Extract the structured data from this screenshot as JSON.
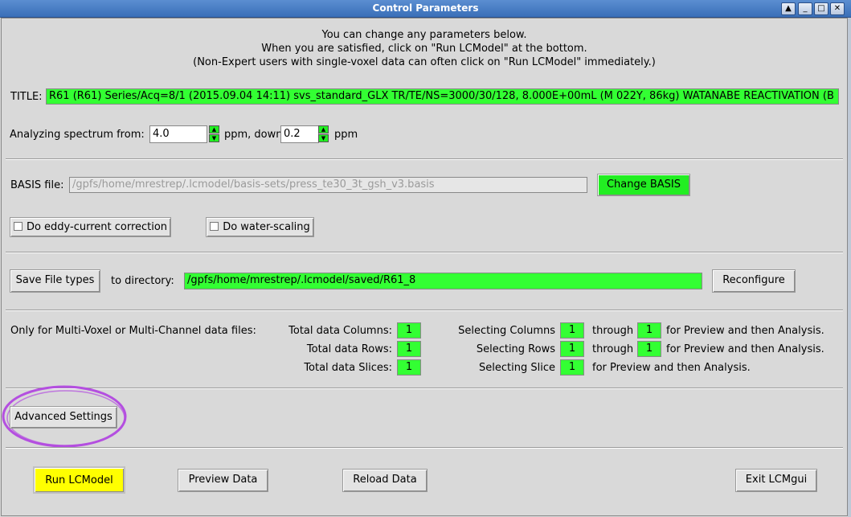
{
  "window": {
    "title": "Control Parameters"
  },
  "intro": [
    "You can change any parameters below.",
    "When you are satisfied, click on \"Run LCModel\" at the bottom.",
    "(Non-Expert users with single-voxel data can often click on \"Run LCModel\" immediately.)"
  ],
  "title_row": {
    "label": "TITLE:",
    "value": "R61 (R61) Series/Acq=8/1 (2015.09.04 14:11) svs_standard_GLX  TR/TE/NS=3000/30/128,  8.000E+00mL (M 022Y, 86kg) WATANABE REACTIVATION  (B"
  },
  "ppm": {
    "from_label": "Analyzing spectrum from:",
    "from_value": "4.0",
    "to_label": "ppm, down to:",
    "to_value": "0.2",
    "unit": "ppm"
  },
  "basis": {
    "label": "BASIS file:",
    "path": "/gpfs/home/mrestrep/.lcmodel/basis-sets/press_te30_3t_gsh_v3.basis",
    "change_button": "Change BASIS"
  },
  "checks": {
    "eddy": "Do eddy-current correction",
    "water": "Do water-scaling"
  },
  "save": {
    "button": "Save File types",
    "dir_label": "to directory:",
    "dir_value": "/gpfs/home/mrestrep/.lcmodel/saved/R61_8",
    "reconfigure": "Reconfigure"
  },
  "multivoxel": {
    "intro": "Only for Multi-Voxel or Multi-Channel data files:",
    "rows": [
      {
        "total_label": "Total data Columns:",
        "total": "1",
        "sel_label": "Selecting Columns",
        "sel_from": "1",
        "through": "through",
        "sel_to": "1",
        "tail": "for Preview and then Analysis."
      },
      {
        "total_label": "Total data Rows:",
        "total": "1",
        "sel_label": "Selecting Rows",
        "sel_from": "1",
        "through": "through",
        "sel_to": "1",
        "tail": "for Preview and then Analysis."
      },
      {
        "total_label": "Total data Slices:",
        "total": "1",
        "sel_label": "Selecting Slice",
        "sel_from": "1",
        "tail": "for Preview and then Analysis."
      }
    ]
  },
  "advanced": {
    "button": "Advanced Settings",
    "highlight_color": "#b44fe0"
  },
  "bottom": {
    "run": "Run LCModel",
    "preview": "Preview Data",
    "reload": "Reload Data",
    "exit": "Exit LCMgui"
  }
}
